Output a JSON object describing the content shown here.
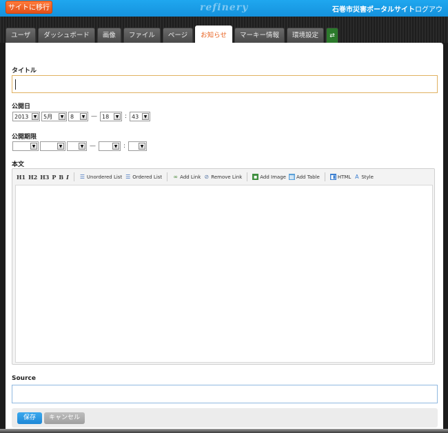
{
  "topbar": {
    "back_label": "サイトに移行",
    "brand": "refinery",
    "site_title": "石巻市災害ポータルサイト",
    "logout": "ログアウト"
  },
  "tabs": [
    {
      "label": "ユーザ"
    },
    {
      "label": "ダッシュボード"
    },
    {
      "label": "画像"
    },
    {
      "label": "ファイル"
    },
    {
      "label": "ページ"
    },
    {
      "label": "お知らせ",
      "active": true
    },
    {
      "label": "マーキー情報"
    },
    {
      "label": "環境設定"
    }
  ],
  "form": {
    "title_label": "タイトル",
    "title_value": "",
    "publish_label": "公開日",
    "publish": {
      "year": "2013",
      "month": "5月",
      "day": "8",
      "hour": "18",
      "minute": "43",
      "dash": "—",
      "colon": ":"
    },
    "expire_label": "公開期限",
    "body_label": "本文",
    "source_label": "Source",
    "source_value": ""
  },
  "toolbar": {
    "h1": "H1",
    "h2": "H2",
    "h3": "H3",
    "p": "P",
    "b": "B",
    "i": "I",
    "unordered": "Unordered List",
    "ordered": "Ordered List",
    "add_link": "Add Link",
    "remove_link": "Remove Link",
    "add_image": "Add Image",
    "add_table": "Add Table",
    "html": "HTML",
    "style": "Style"
  },
  "actions": {
    "save": "保存",
    "cancel": "キャンセル"
  },
  "colors": {
    "topbar": "#1592dd",
    "accent_orange": "#e8601e",
    "save_blue": "#1f88d6"
  }
}
